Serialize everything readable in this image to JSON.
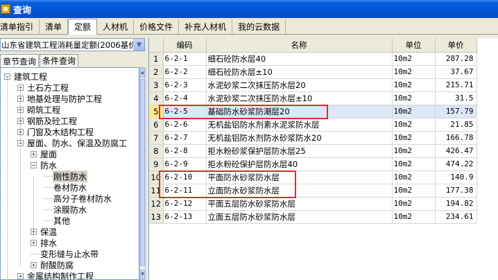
{
  "window": {
    "title": "查询"
  },
  "tabs": [
    "清单指引",
    "清单",
    "定额",
    "人材机",
    "价格文件",
    "补充人材机",
    "我的云数据"
  ],
  "active_tab_index": 2,
  "left": {
    "combo_value": "山东省建筑工程消耗量定额(2006基价",
    "subtabs": [
      "章节查询",
      "条件查询"
    ],
    "tree": [
      {
        "label": "建筑工程",
        "toggle": "−"
      },
      {
        "label": "土石方工程",
        "toggle": "+"
      },
      {
        "label": "地基处理与防护工程",
        "toggle": "+"
      },
      {
        "label": "砌筑工程",
        "toggle": "+"
      },
      {
        "label": "钢筋及砼工程",
        "toggle": "+"
      },
      {
        "label": "门窗及木结构工程",
        "toggle": "+"
      },
      {
        "label": "屋面、防水、保温及防腐工",
        "toggle": "−"
      },
      {
        "label": "屋面",
        "toggle": "+"
      },
      {
        "label": "防水",
        "toggle": "−"
      },
      {
        "label": "刚性防水",
        "toggle": ""
      },
      {
        "label": "卷材防水",
        "toggle": ""
      },
      {
        "label": "高分子卷材防水",
        "toggle": ""
      },
      {
        "label": "涂膜防水",
        "toggle": ""
      },
      {
        "label": "其他",
        "toggle": ""
      },
      {
        "label": "保温",
        "toggle": "+"
      },
      {
        "label": "排水",
        "toggle": "+"
      },
      {
        "label": "变形缝与止水带",
        "toggle": ""
      },
      {
        "label": "耐酸防腐",
        "toggle": "+"
      },
      {
        "label": "金属结构制作工程",
        "toggle": "+"
      }
    ]
  },
  "grid": {
    "headers": [
      "编码",
      "名称",
      "单位",
      "单价"
    ],
    "rows": [
      [
        "6-2-1",
        "细石砼防水层40",
        "10m2",
        "287.28"
      ],
      [
        "6-2-2",
        "细石砼防水层±10",
        "10m2",
        "37.67"
      ],
      [
        "6-2-3",
        "水泥砂浆二次抹压防水层20",
        "10m2",
        "215.71"
      ],
      [
        "6-2-4",
        "水泥砂浆二次抹压防水层±10",
        "10m2",
        "31.5"
      ],
      [
        "6-2-5",
        "基础防水砂浆防潮层20",
        "10m2",
        "157.79"
      ],
      [
        "6-2-6",
        "无机盐铝防水剂素水泥浆防水层",
        "10m2",
        "21.85"
      ],
      [
        "6-2-7",
        "无机盐铝防水剂防水砂浆防水20",
        "10m2",
        "166.78"
      ],
      [
        "6-2-8",
        "拒水粉砂浆保护层防水层25",
        "10m2",
        "426.47"
      ],
      [
        "6-2-9",
        "拒水粉砼保护层防水层40",
        "10m2",
        "474.22"
      ],
      [
        "6-2-10",
        "平面防水砂浆防水层",
        "10m2",
        "140.9"
      ],
      [
        "6-2-11",
        "立面防水砂浆防水层",
        "10m2",
        "177.38"
      ],
      [
        "6-2-12",
        "平面五层防水砂浆防水层",
        "10m2",
        "194.82"
      ],
      [
        "6-2-13",
        "立面五层防水砂浆防水层",
        "10m2",
        "234.61"
      ]
    ],
    "selected_row": 5
  }
}
